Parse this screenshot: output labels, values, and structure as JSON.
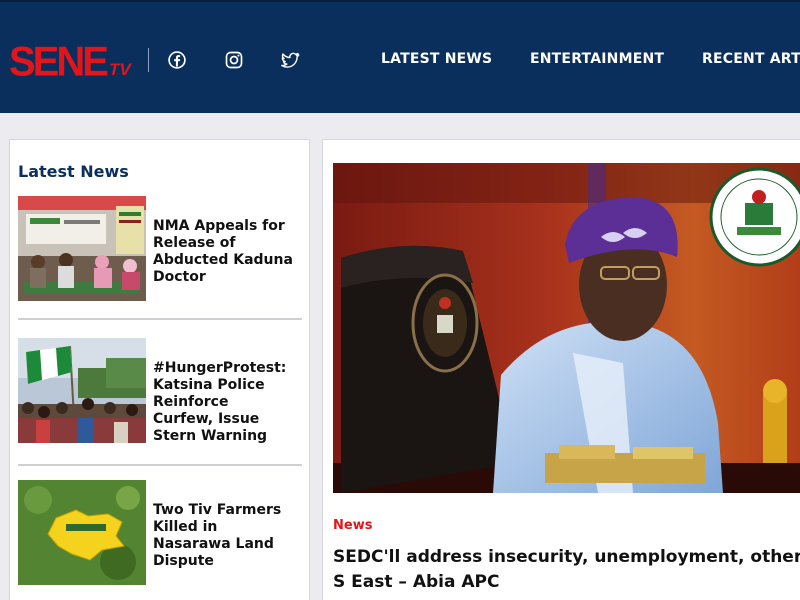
{
  "header": {
    "logo_main": "SENE",
    "logo_suffix": "TV",
    "social": [
      {
        "icon": "facebook-icon"
      },
      {
        "icon": "instagram-icon"
      },
      {
        "icon": "twitter-icon"
      }
    ],
    "nav": [
      "LATEST NEWS",
      "ENTERTAINMENT",
      "RECENT ARTI"
    ]
  },
  "sidebar": {
    "title": "Latest News",
    "items": [
      {
        "title": "NMA Appeals for Release of Abducted Kaduna Doctor"
      },
      {
        "title": "#HungerProtest: Katsina Police Reinforce Curfew, Issue Stern Warning"
      },
      {
        "title": "Two Tiv Farmers Killed in Nasarawa Land Dispute"
      }
    ]
  },
  "featured": {
    "category": "News",
    "headline": "SEDC'll address insecurity, unemployment, others in S East – Abia APC"
  },
  "colors": {
    "header_bg": "#0b2f5c",
    "brand_red": "#e3151b",
    "page_bg": "#ecebef",
    "title_blue": "#0b2f5c"
  }
}
